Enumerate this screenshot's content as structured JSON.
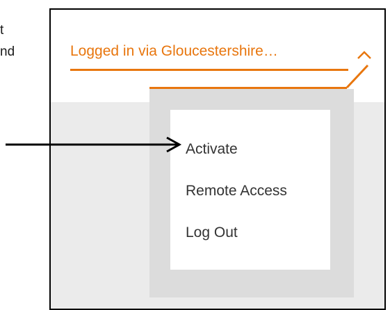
{
  "background_text": {
    "line1": "t",
    "line2": "nd"
  },
  "account_menu": {
    "toggle_label": "Logged in via Gloucestershire…",
    "toggle_icon": "chevron-up-icon",
    "items": [
      {
        "label": "Activate"
      },
      {
        "label": "Remote Access"
      },
      {
        "label": "Log Out"
      }
    ]
  },
  "colors": {
    "accent": "#e8760e",
    "menu_backdrop": "#dcdcdc",
    "content_bg": "#ebebeb",
    "annotation": "#000000"
  },
  "annotation": {
    "icon": "arrow-right-icon",
    "points_to": "Activate"
  }
}
